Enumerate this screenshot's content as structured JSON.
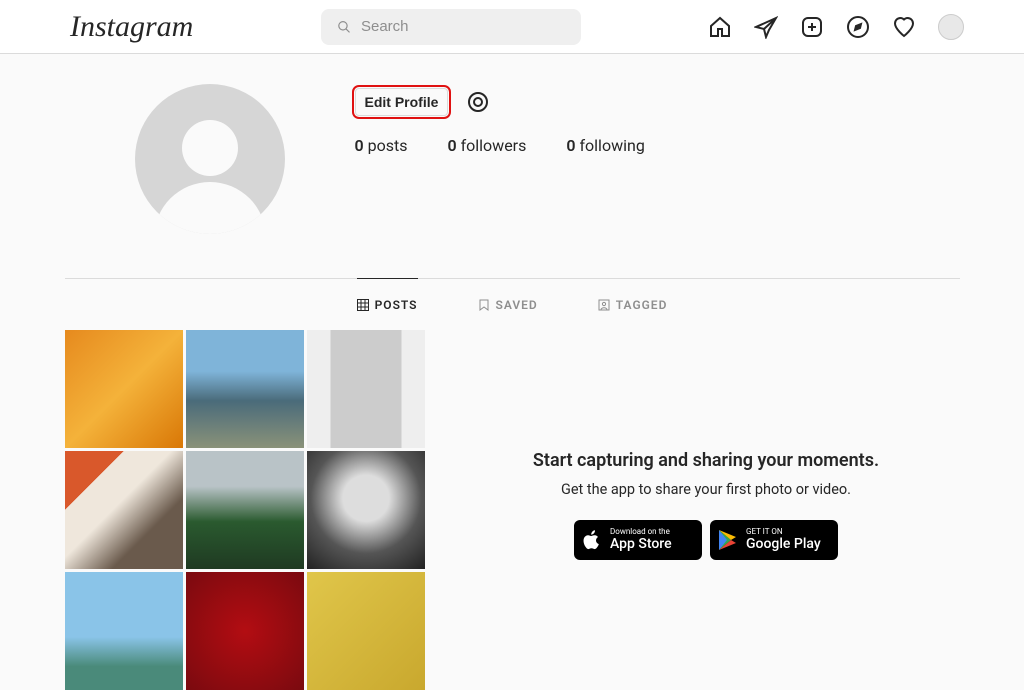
{
  "brand": "Instagram",
  "search": {
    "placeholder": "Search"
  },
  "profile": {
    "edit_label": "Edit Profile",
    "stats": {
      "posts_count": "0",
      "posts_label": "posts",
      "followers_count": "0",
      "followers_label": "followers",
      "following_count": "0",
      "following_label": "following"
    }
  },
  "tabs": {
    "posts": "POSTS",
    "saved": "SAVED",
    "tagged": "TAGGED"
  },
  "promo": {
    "heading": "Start capturing and sharing your moments.",
    "sub": "Get the app to share your first photo or video.",
    "appstore_small": "Download on the",
    "appstore_big": "App Store",
    "play_small": "GET IT ON",
    "play_big": "Google Play"
  },
  "grid": [
    {
      "name": "oranges",
      "bg": "linear-gradient(135deg,#e68a1e,#f4b23a,#d97706)"
    },
    {
      "name": "coastal-cliffs",
      "bg": "linear-gradient(180deg,#7fb4d9 35%,#4a6b7a 60%,#8a9279)"
    },
    {
      "name": "photo-strip",
      "bg": "linear-gradient(90deg,#eee 20%,#ccc 20%,#ccc 80%,#eee 80%)"
    },
    {
      "name": "dog-blanket",
      "bg": "linear-gradient(135deg,#d9582b 25%,#efe7dc 25%,#efe7dc 45%,#6a5a4c 70%)"
    },
    {
      "name": "cactus-bldg",
      "bg": "linear-gradient(180deg,#b9c3c7 30%,#2a5a2f 60%,#1f3a22)"
    },
    {
      "name": "baby-bw",
      "bg": "radial-gradient(circle at 50% 40%,#ddd 25%,#555 60%,#222)"
    },
    {
      "name": "ski-lift",
      "bg": "linear-gradient(180deg,#8ac4e8 55%,#4a8a7a 80%)"
    },
    {
      "name": "red-flowers",
      "bg": "radial-gradient(circle,#b30d12,#7a0a0f)"
    },
    {
      "name": "cat-camera",
      "bg": "linear-gradient(135deg,#e0c64a,#c9a82e)"
    }
  ]
}
